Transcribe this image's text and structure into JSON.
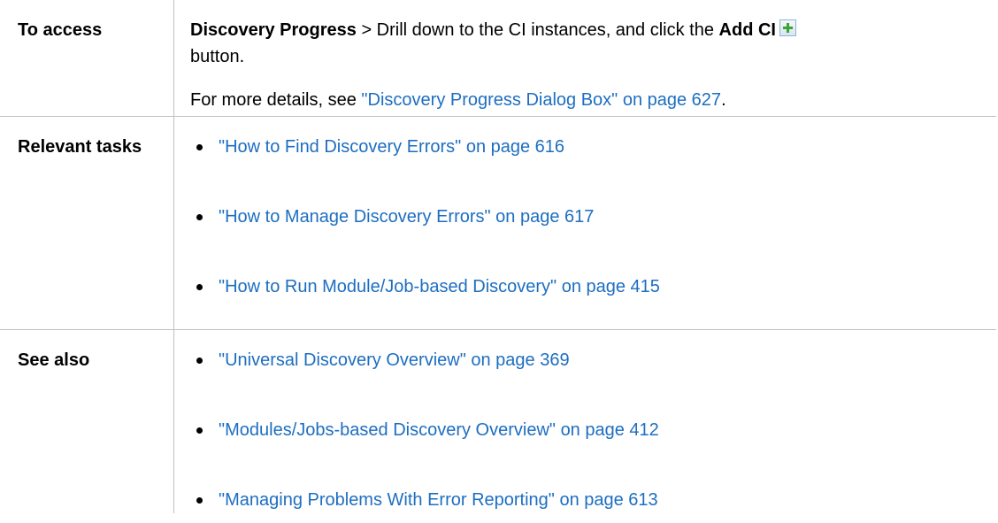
{
  "rows": {
    "access": {
      "label": "To access",
      "line1_bold": "Discovery Progress",
      "line1_text": " > Drill down to the CI instances, and click the ",
      "line1_bold2": "Add CI",
      "line1_end": "button.",
      "line2_prefix": "For more details, see ",
      "line2_link": "\"Discovery Progress Dialog Box\" on page 627",
      "line2_suffix": "."
    },
    "tasks": {
      "label": "Relevant tasks",
      "items": [
        "\"How to Find Discovery Errors\" on page 616",
        "\"How to Manage Discovery Errors\" on page 617",
        "\"How to Run Module/Job-based Discovery\" on page 415"
      ]
    },
    "also": {
      "label": "See also",
      "items": [
        "\"Universal Discovery Overview\" on page 369",
        "\"Modules/Jobs-based Discovery Overview\" on page 412",
        "\"Managing Problems With Error Reporting\" on page 613"
      ]
    }
  },
  "icons": {
    "add_ci": "add-ci-icon"
  },
  "colors": {
    "link": "#1d6ec1",
    "border": "#c0c0c0",
    "icon_plus": "#3aa62f"
  }
}
